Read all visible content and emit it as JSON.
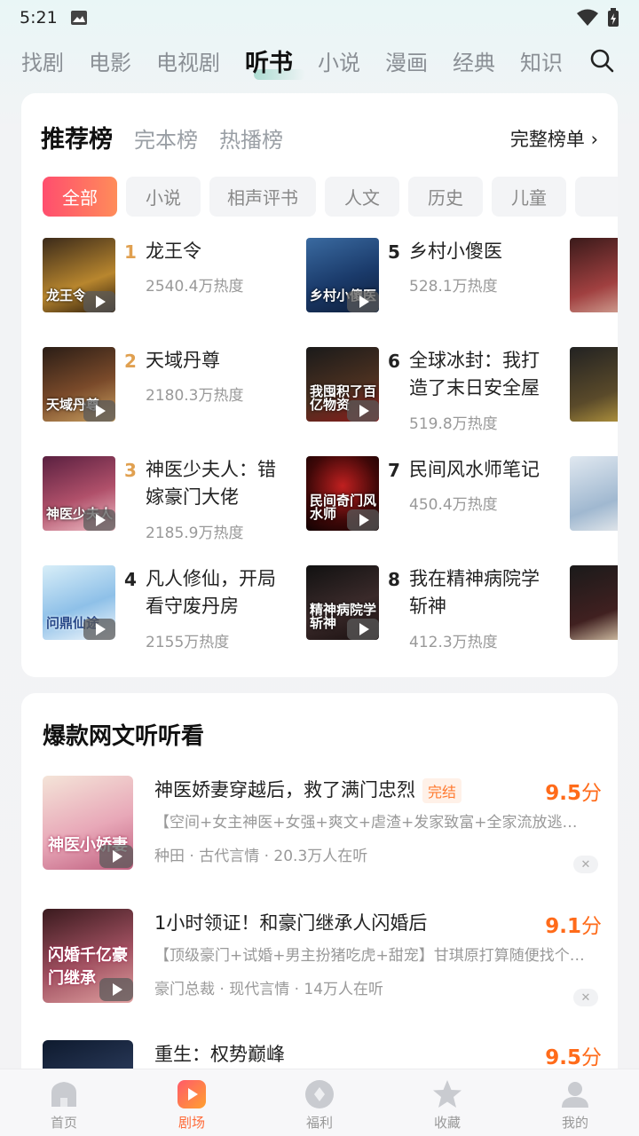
{
  "status": {
    "time": "5:21"
  },
  "top_nav": {
    "tabs": [
      "找剧",
      "电影",
      "电视剧",
      "听书",
      "小说",
      "漫画",
      "经典",
      "知识"
    ],
    "active_index": 3
  },
  "rank": {
    "tabs": [
      "推荐榜",
      "完本榜",
      "热播榜"
    ],
    "full_list": "完整榜单 ›",
    "chips": [
      "全部",
      "小说",
      "相声评书",
      "人文",
      "历史",
      "儿童"
    ],
    "items": [
      {
        "num": "1",
        "title": "龙王令",
        "heat": "2540.4万热度",
        "cover_text": "龙王令"
      },
      {
        "num": "2",
        "title": "天域丹尊",
        "heat": "2180.3万热度",
        "cover_text": "天域丹尊"
      },
      {
        "num": "3",
        "title": "神医少夫人：错嫁豪门大佬",
        "heat": "2185.9万热度",
        "cover_text": "神医少夫人"
      },
      {
        "num": "4",
        "title": "凡人修仙，开局看守废丹房",
        "heat": "2155万热度",
        "cover_text": "问鼎仙途"
      },
      {
        "num": "5",
        "title": "乡村小傻医",
        "heat": "528.1万热度",
        "cover_text": "乡村小傻医"
      },
      {
        "num": "6",
        "title": "全球冰封：我打造了末日安全屋",
        "heat": "519.8万热度",
        "cover_text": "我囤积了百亿物资"
      },
      {
        "num": "7",
        "title": "民间风水师笔记",
        "heat": "450.4万热度",
        "cover_text": "民间奇门风水师"
      },
      {
        "num": "8",
        "title": "我在精神病院学斩神",
        "heat": "412.3万热度",
        "cover_text": "精神病院学斩神"
      }
    ]
  },
  "hot": {
    "title": "爆款网文听听看",
    "items": [
      {
        "name": "神医娇妻穿越后，救了满门忠烈",
        "badge": "完结",
        "score": "9.5",
        "unit": "分",
        "desc": "【空间+女主神医+女强+爽文+虐渣+发家致富+全家流放逃荒…",
        "meta": "种田 · 古代言情 · 20.3万人在听",
        "cover_text": "神医小娇妻"
      },
      {
        "name": "1小时领证！和豪门继承人闪婚后",
        "badge": "",
        "score": "9.1",
        "unit": "分",
        "desc": "【顶级豪门+试婚+男主扮猪吃虎+甜宠】甘琪原打算随便找个…",
        "meta": "豪门总裁 · 现代言情 · 14万人在听",
        "cover_text": "闪婚千亿豪门继承"
      },
      {
        "name": "重生：权势巅峰",
        "badge": "",
        "score": "9.5",
        "unit": "分",
        "desc": "",
        "meta": "",
        "cover_text": ""
      }
    ]
  },
  "bottom_nav": {
    "items": [
      "首页",
      "剧场",
      "福利",
      "收藏",
      "我的"
    ],
    "active_index": 1
  }
}
